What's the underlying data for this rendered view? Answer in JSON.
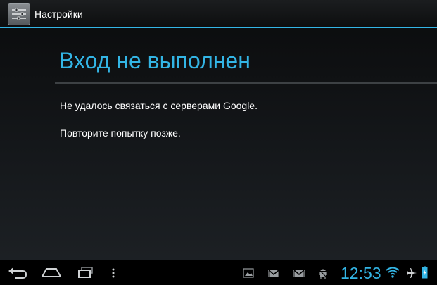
{
  "actionbar": {
    "title": "Настройки",
    "icon": "settings-sliders-icon"
  },
  "dialog": {
    "title": "Вход не выполнен",
    "message_line1": "Не удалось связаться с серверами Google.",
    "message_line2": "Повторите попытку позже."
  },
  "systembar": {
    "clock": "12:53",
    "nav_icons": [
      "back-icon",
      "home-icon",
      "recent-apps-icon",
      "menu-icon"
    ],
    "status_icons": [
      "picture-notification-icon",
      "gmail-icon",
      "gmail-icon",
      "android-debug-icon",
      "wifi-icon",
      "airplane-icon",
      "battery-icon"
    ]
  },
  "colors": {
    "accent": "#33b5e5",
    "text": "#ffffff",
    "background": "#111315"
  }
}
